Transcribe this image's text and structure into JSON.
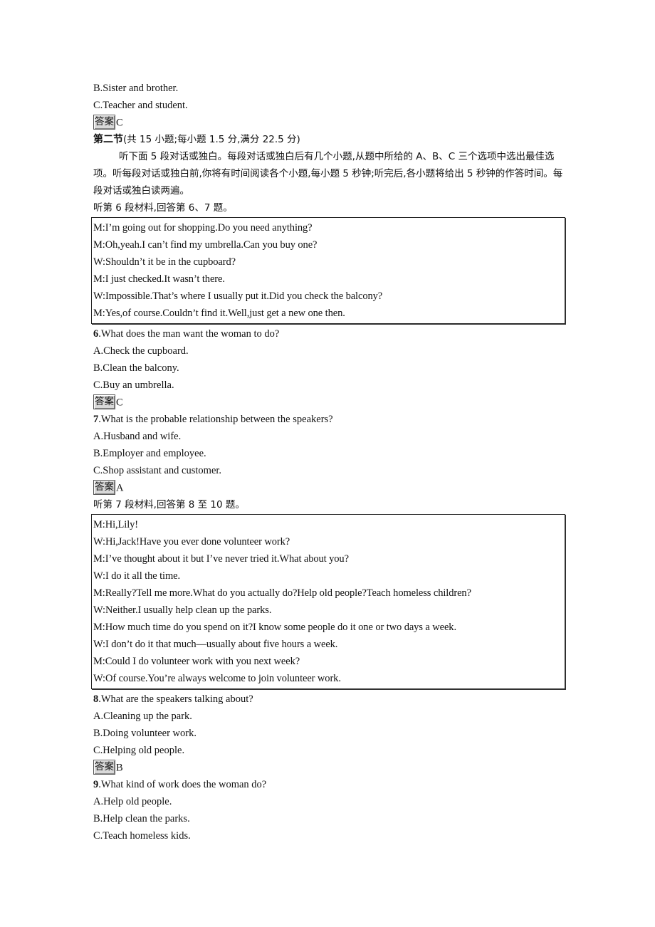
{
  "prev_question_tail": {
    "options": [
      "B.Sister and brother.",
      "C.Teacher and student."
    ],
    "answer_label": "答案",
    "answer": "C"
  },
  "section": {
    "title": "第二节",
    "subtitle": "(共 15  小题;每小题 1.5 分,满分 22.5 分)",
    "instructions": "听下面 5 段对话或独白。每段对话或独白后有几个小题,从题中所给的 A、B、C 三个选项中选出最佳选项。听每段对话或独白前,你将有时间阅读各个小题,每小题 5 秒钟;听完后,各小题将给出 5 秒钟的作答时间。每段对话或独白读两遍。"
  },
  "material6": {
    "intro": "听第 6 段材料,回答第 6、7 题。",
    "dialog": [
      "M:I’m going out for shopping.Do you need anything?",
      "M:Oh,yeah.I can’t find my umbrella.Can you buy one?",
      "W:Shouldn’t it be in the cupboard?",
      "M:I just checked.It wasn’t there.",
      "W:Impossible.That’s where I usually put it.Did you check the balcony?",
      "M:Yes,of course.Couldn’t find it.Well,just get a new one then."
    ],
    "questions": [
      {
        "num": "6",
        "text": ".What does the man want the woman to do?",
        "options": [
          "A.Check the cupboard.",
          "B.Clean the balcony.",
          "C.Buy an umbrella."
        ],
        "answer_label": "答案",
        "answer": "C"
      },
      {
        "num": "7",
        "text": ".What is the probable relationship between the speakers?",
        "options": [
          "A.Husband and wife.",
          "B.Employer and employee.",
          "C.Shop assistant and customer."
        ],
        "answer_label": "答案",
        "answer": "A"
      }
    ]
  },
  "material7": {
    "intro": "听第 7 段材料,回答第 8 至 10 题。",
    "dialog": [
      "M:Hi,Lily!",
      "W:Hi,Jack!Have you ever done volunteer work?",
      "M:I’ve thought about it but I’ve never tried it.What about you?",
      "W:I do it all the time.",
      "M:Really?Tell me more.What do you actually do?Help old people?Teach homeless children?",
      "W:Neither.I usually help clean up the parks.",
      "M:How much time do you spend on it?I know some people do it one or two days a week.",
      "W:I don’t do it that much—usually about five hours a week.",
      "M:Could I do volunteer work with you next week?",
      "W:Of course.You’re always welcome to join volunteer work."
    ],
    "questions": [
      {
        "num": "8",
        "text": ".What are the speakers talking about?",
        "options": [
          "A.Cleaning up the park.",
          "B.Doing volunteer work.",
          "C.Helping old people."
        ],
        "answer_label": "答案",
        "answer": "B"
      },
      {
        "num": "9",
        "text": ".What kind of work does the woman do?",
        "options": [
          "A.Help old people.",
          "B.Help clean the parks.",
          "C.Teach homeless kids."
        ]
      }
    ]
  }
}
